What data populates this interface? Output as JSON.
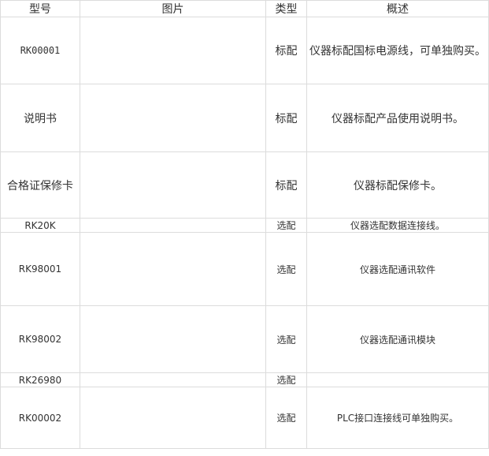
{
  "header": {
    "model": "型号",
    "image": "图片",
    "type": "类型",
    "desc": "概述"
  },
  "rows": [
    {
      "model": "RK00001",
      "type": "标配",
      "desc": "仪器标配国标电源线，可单独购买。"
    },
    {
      "model": "说明书",
      "type": "标配",
      "desc": "仪器标配产品使用说明书。"
    },
    {
      "model": "合格证保修卡",
      "type": "标配",
      "desc": "仪器标配保修卡。"
    },
    {
      "model": "RK20K",
      "type": "选配",
      "desc": "仪器选配数据连接线。"
    },
    {
      "model": "RK98001",
      "type": "选配",
      "desc": "仪器选配通讯软件"
    },
    {
      "model": "RK98002",
      "type": "选配",
      "desc": "仪器选配通讯模块"
    },
    {
      "model": "RK26980",
      "type": "选配",
      "desc": ""
    },
    {
      "model": "RK00002",
      "type": "选配",
      "desc": "PLC接口连接线可单独购买。"
    }
  ]
}
